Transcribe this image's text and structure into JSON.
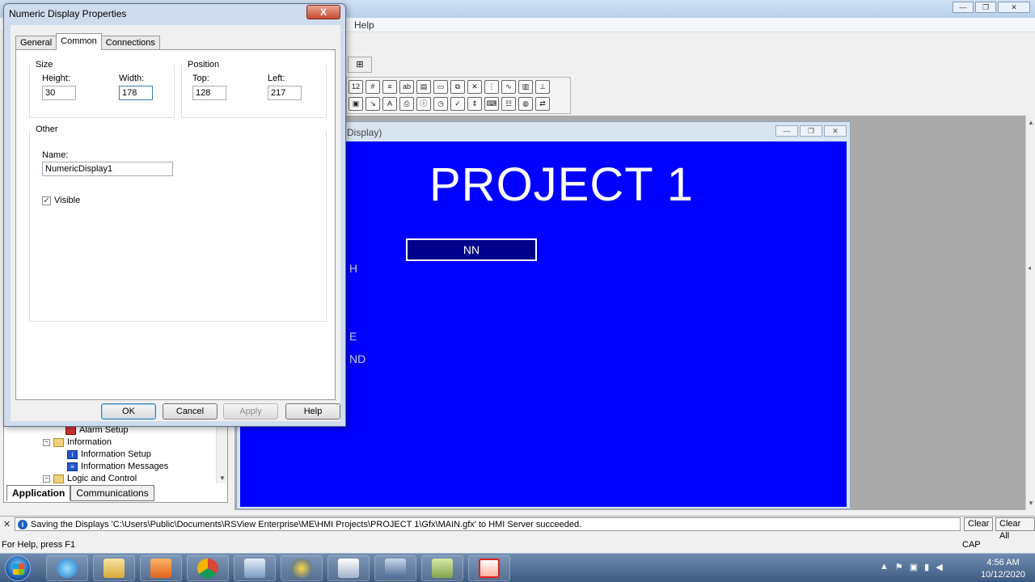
{
  "app": {
    "menu": {
      "help_label": "Help"
    },
    "toolbar": {
      "small_label": "⊞"
    },
    "display_window": {
      "title_fragment": "Display)",
      "heading": "PROJECT 1",
      "numeric_text": "NN",
      "fragments": [
        "H",
        "E",
        "ND"
      ]
    },
    "explorer": {
      "items": [
        {
          "label": "Alarm Setup"
        },
        {
          "label": "Information"
        },
        {
          "label": "Information Setup"
        },
        {
          "label": "Information Messages"
        },
        {
          "label": "Logic and Control"
        }
      ],
      "tabs": [
        {
          "label": "Application"
        },
        {
          "label": "Communications"
        }
      ]
    },
    "output": {
      "message": "Saving the Displays 'C:\\Users\\Public\\Documents\\RSView Enterprise\\ME\\HMI Projects\\PROJECT 1\\Gfx\\MAIN.gfx' to HMI Server succeeded.",
      "clear_label": "Clear",
      "clear_all_label": "Clear All"
    },
    "statusbar": {
      "help_text": "For Help, press F1",
      "caps": "CAP"
    }
  },
  "dialog": {
    "title": "Numeric Display Properties",
    "close_label": "X",
    "tabs": [
      {
        "label": "General"
      },
      {
        "label": "Common"
      },
      {
        "label": "Connections"
      }
    ],
    "size": {
      "label": "Size",
      "height_label": "Height:",
      "height_value": "30",
      "width_label": "Width:",
      "width_value": "178"
    },
    "position": {
      "label": "Position",
      "top_label": "Top:",
      "top_value": "128",
      "left_label": "Left:",
      "left_value": "217"
    },
    "other": {
      "label": "Other",
      "name_label": "Name:",
      "name_value": "NumericDisplay1",
      "visible_label": "Visible",
      "visible_checked": true
    },
    "buttons": {
      "ok": "OK",
      "cancel": "Cancel",
      "apply": "Apply",
      "help": "Help"
    }
  },
  "taskbar": {
    "apps": [
      "start",
      "internet-explorer",
      "file-explorer",
      "media-player",
      "chrome",
      "rsview-studio",
      "rslinx",
      "network-tool",
      "factorytalk",
      "app-green",
      "pdf-tool"
    ],
    "clock": {
      "time": "4:56 AM",
      "date": "10/12/2020"
    }
  },
  "colors": {
    "canvas": "#0000ff",
    "numeric_bg": "#00008b",
    "dialog_frame": "#cfdcee"
  }
}
